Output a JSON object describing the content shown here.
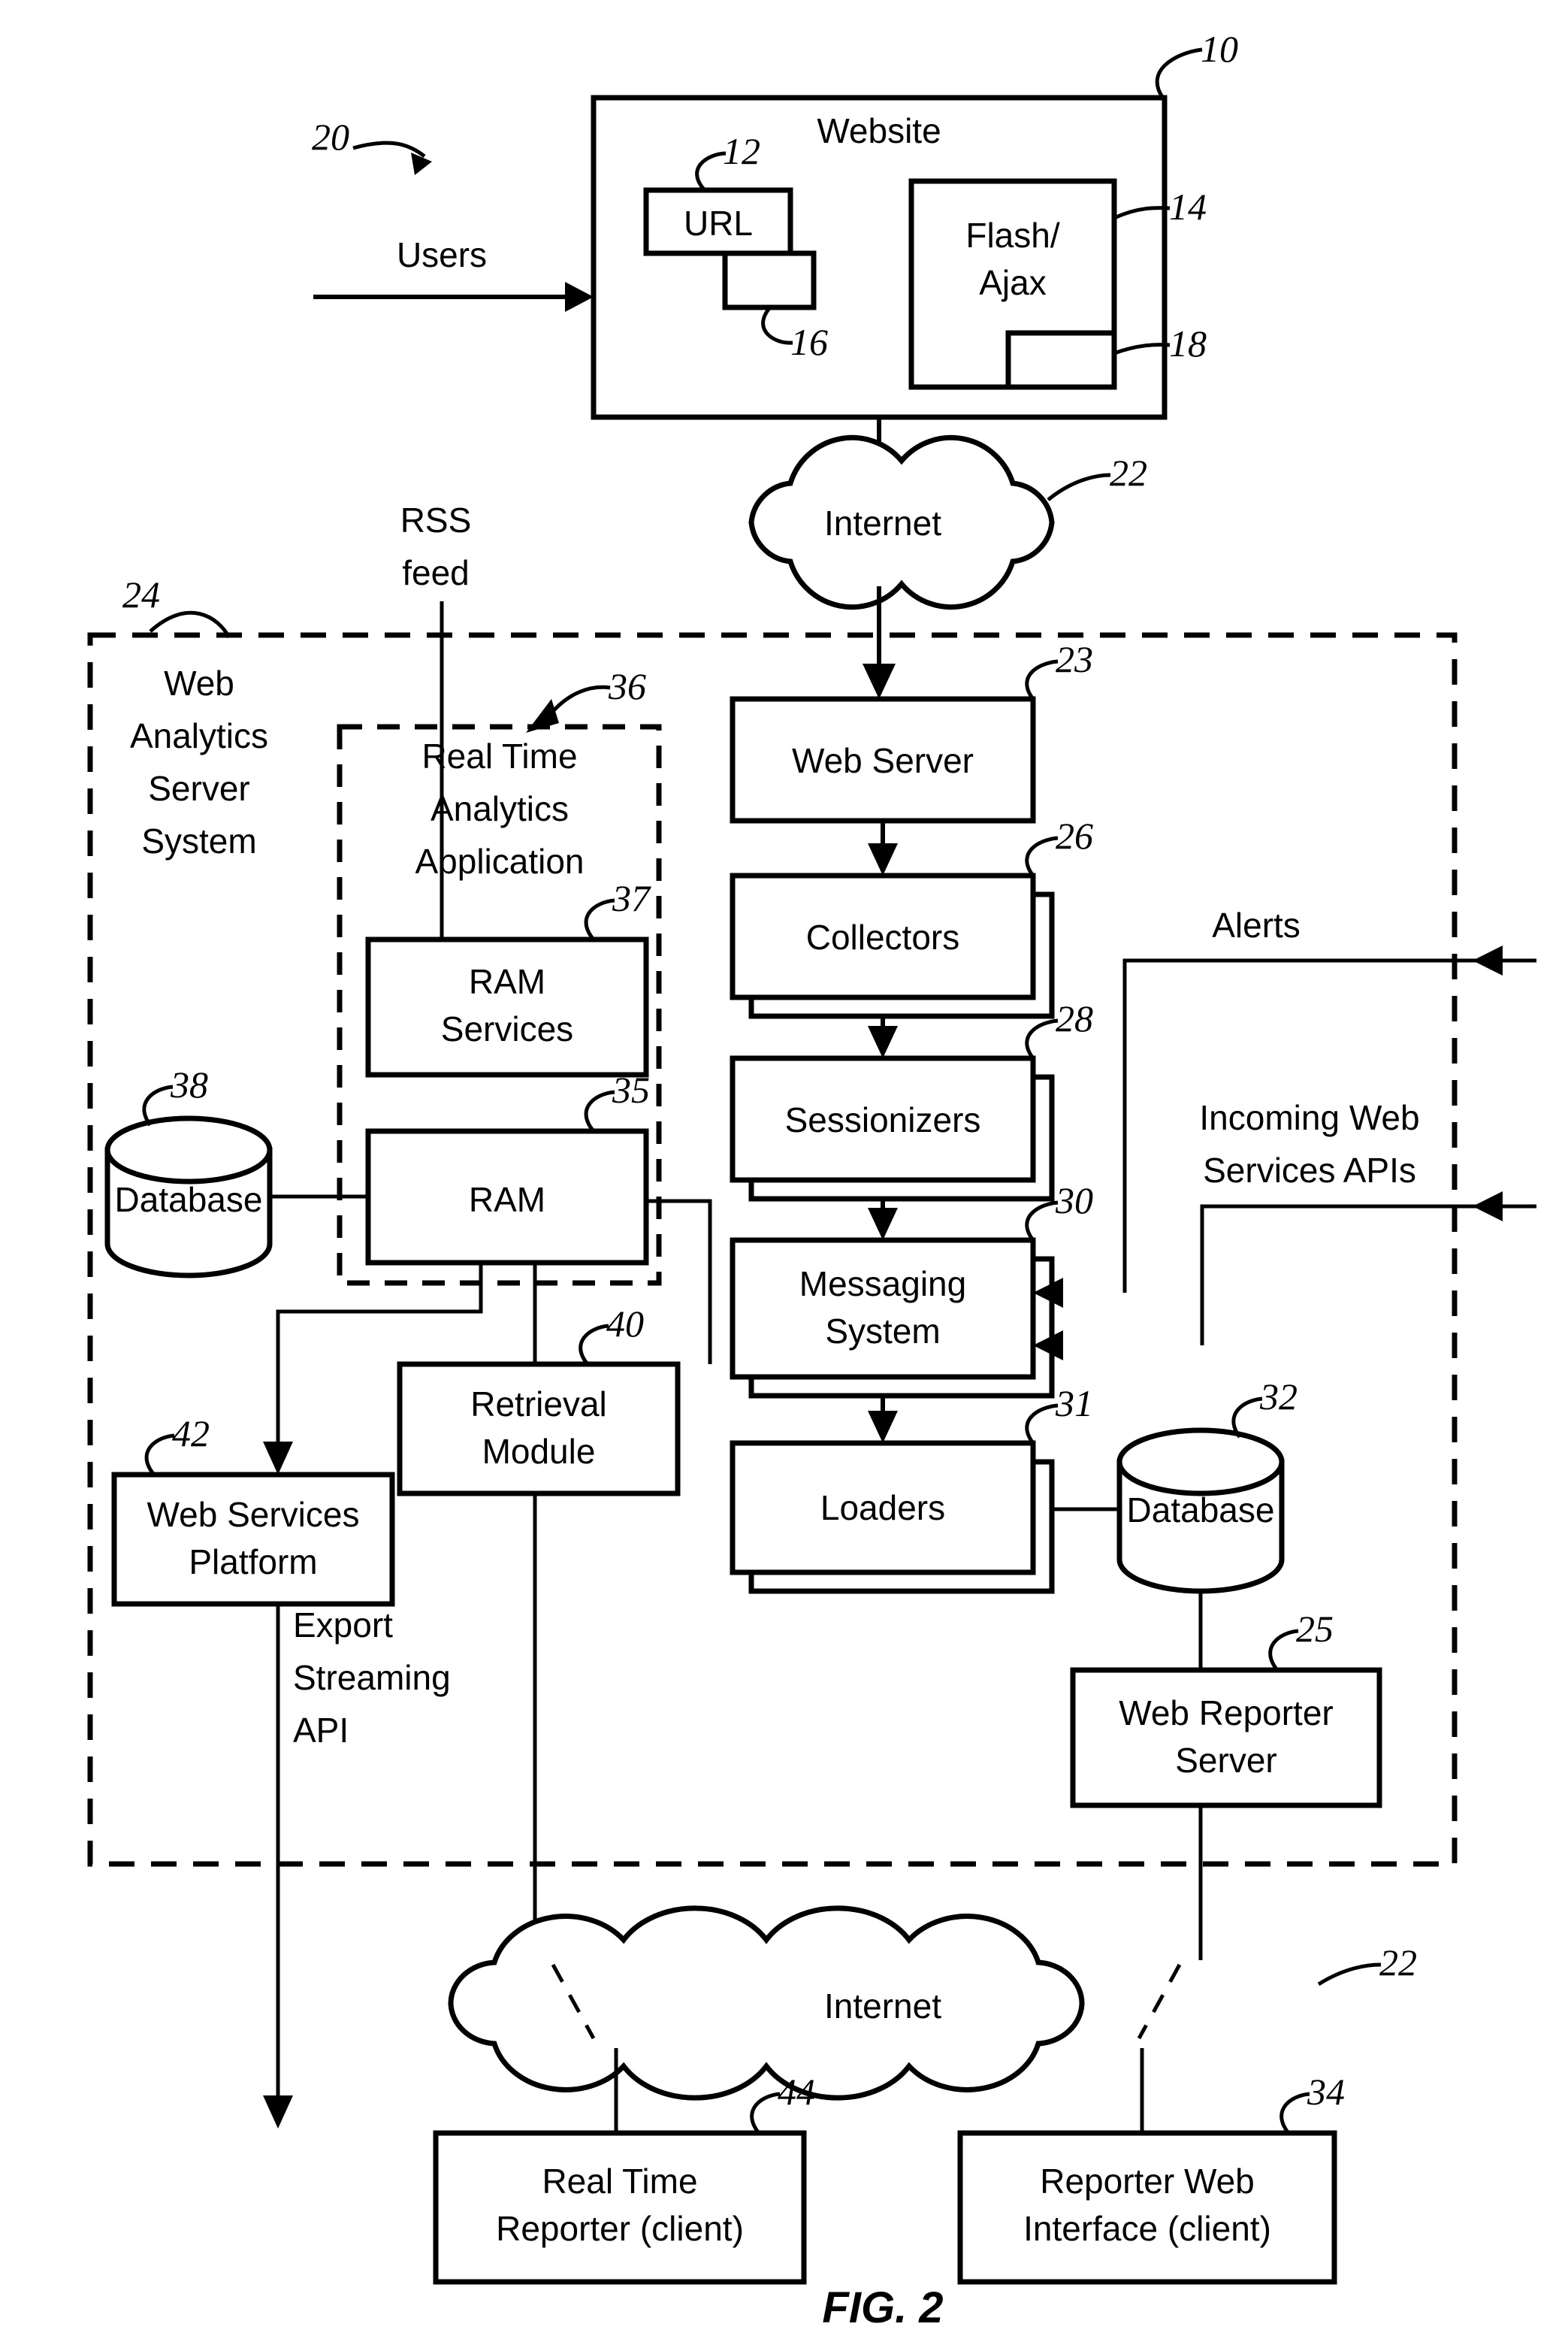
{
  "figure": {
    "caption": "FIG. 2"
  },
  "nodes": {
    "website": {
      "label": "Website",
      "ref": "10"
    },
    "url": {
      "label": "URL",
      "ref": "12"
    },
    "page_box": {
      "label": "",
      "ref": "16"
    },
    "flash_ajax": {
      "label_line1": "Flash/",
      "label_line2": "Ajax",
      "ref": "14"
    },
    "flash_inner": {
      "label": "",
      "ref": "18"
    },
    "internet_top": {
      "label": "Internet",
      "ref": "22"
    },
    "internet_bottom": {
      "label": "Internet",
      "ref": "22"
    },
    "was_system": {
      "label_line1": "Web",
      "label_line2": "Analytics",
      "label_line3": "Server",
      "label_line4": "System",
      "ref": "24"
    },
    "rt_analytics": {
      "label_line1": "Real Time",
      "label_line2": "Analytics",
      "label_line3": "Application",
      "ref": "36"
    },
    "ram_services": {
      "label_line1": "RAM",
      "label_line2": "Services",
      "ref": "37"
    },
    "ram": {
      "label": "RAM",
      "ref": "35"
    },
    "database_left": {
      "label": "Database",
      "ref": "38"
    },
    "retrieval": {
      "label_line1": "Retrieval",
      "label_line2": "Module",
      "ref": "40"
    },
    "wsp": {
      "label_line1": "Web Services",
      "label_line2": "Platform",
      "ref": "42"
    },
    "web_server": {
      "label": "Web Server",
      "ref": "23"
    },
    "collectors": {
      "label": "Collectors",
      "ref": "26"
    },
    "sessionizers": {
      "label": "Sessionizers",
      "ref": "28"
    },
    "messaging": {
      "label_line1": "Messaging",
      "label_line2": "System",
      "ref": "30"
    },
    "loaders": {
      "label": "Loaders",
      "ref": "31"
    },
    "database_right": {
      "label": "Database",
      "ref": "32"
    },
    "web_reporter": {
      "label_line1": "Web Reporter",
      "label_line2": "Server",
      "ref": "25"
    },
    "rt_reporter": {
      "label_line1": "Real Time",
      "label_line2": "Reporter (client)",
      "ref": "44"
    },
    "reporter_web": {
      "label_line1": "Reporter Web",
      "label_line2": "Interface (client)",
      "ref": "34"
    }
  },
  "edge_labels": {
    "users": {
      "label": "Users",
      "ref": "20"
    },
    "rss_feed": {
      "label_line1": "RSS",
      "label_line2": "feed"
    },
    "alerts": {
      "label": "Alerts"
    },
    "incoming_ws": {
      "label_line1": "Incoming Web",
      "label_line2": "Services APIs"
    },
    "export_api": {
      "label_line1": "Export",
      "label_line2": "Streaming",
      "label_line3": "API"
    }
  }
}
